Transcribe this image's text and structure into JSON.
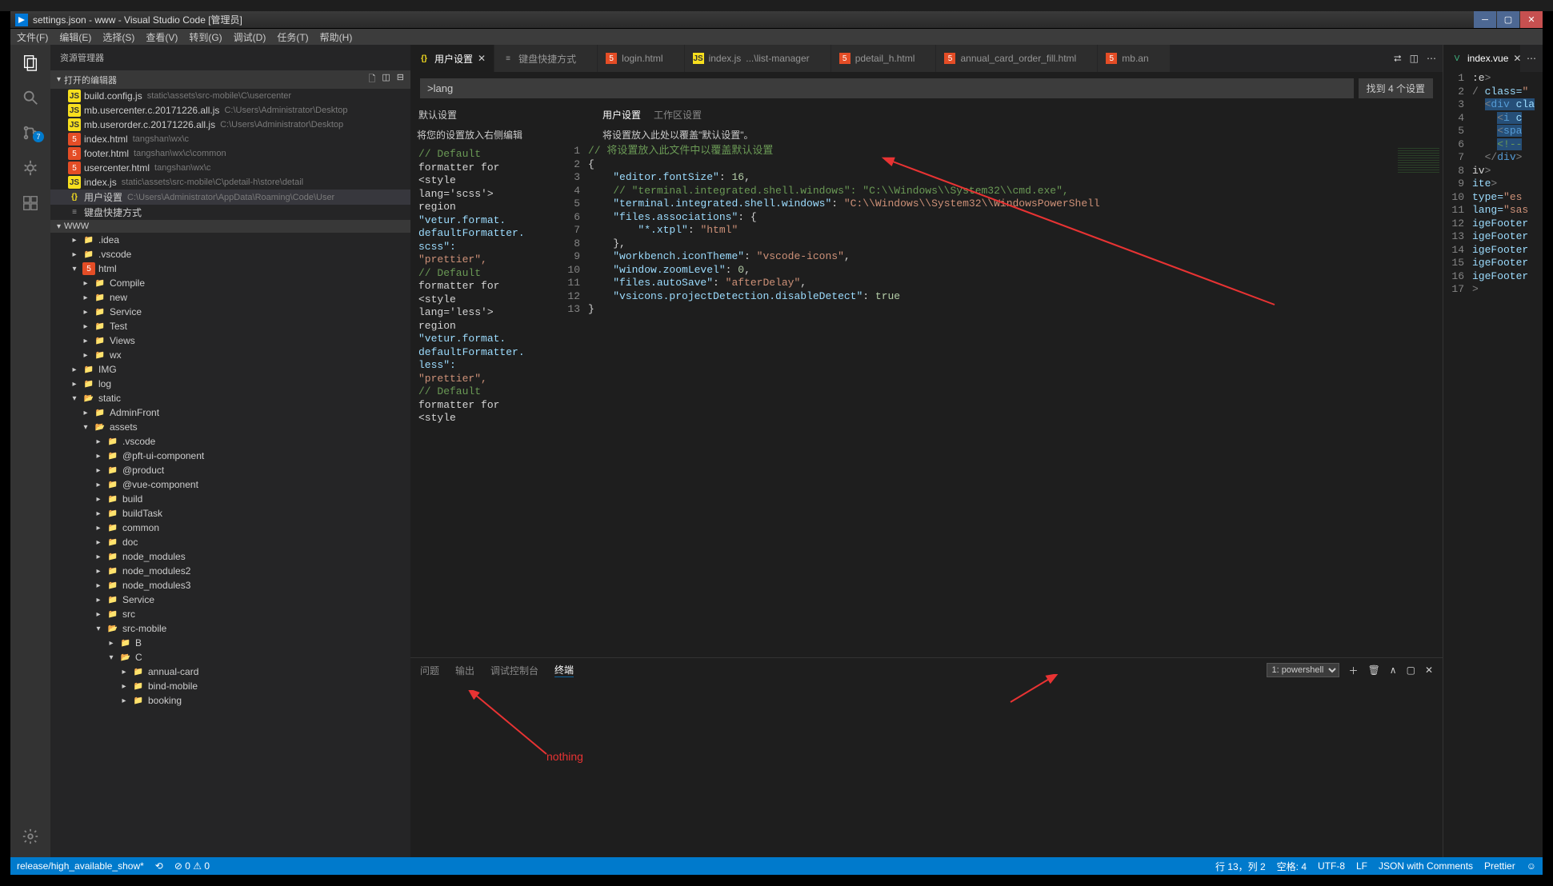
{
  "title": "settings.json - www - Visual Studio Code [管理员]",
  "menu": [
    "文件(F)",
    "编辑(E)",
    "选择(S)",
    "查看(V)",
    "转到(G)",
    "调试(D)",
    "任务(T)",
    "帮助(H)"
  ],
  "activity_badge": "7",
  "sidebar": {
    "title": "资源管理器",
    "open_editors_label": "打开的编辑器",
    "open_editors": [
      {
        "icon": "js",
        "name": "build.config.js",
        "dim": "static\\assets\\src-mobile\\C\\usercenter"
      },
      {
        "icon": "js",
        "name": "mb.usercenter.c.20171226.all.js",
        "dim": "C:\\Users\\Administrator\\Desktop"
      },
      {
        "icon": "js",
        "name": "mb.userorder.c.20171226.all.js",
        "dim": "C:\\Users\\Administrator\\Desktop"
      },
      {
        "icon": "html5",
        "name": "index.html",
        "dim": "tangshan\\wx\\c"
      },
      {
        "icon": "html5",
        "name": "footer.html",
        "dim": "tangshan\\wx\\c\\common"
      },
      {
        "icon": "html5",
        "name": "usercenter.html",
        "dim": "tangshan\\wx\\c"
      },
      {
        "icon": "js",
        "name": "index.js",
        "dim": "static\\assets\\src-mobile\\C\\pdetail-h\\store\\detail"
      },
      {
        "icon": "json",
        "name": "用户设置",
        "dim": "C:\\Users\\Administrator\\AppData\\Roaming\\Code\\User",
        "selected": true
      },
      {
        "icon": "txt",
        "name": "键盘快捷方式",
        "dim": ""
      }
    ],
    "root": "WWW",
    "tree": [
      {
        "indent": 1,
        "chev": "▸",
        "icon": "folder",
        "name": ".idea"
      },
      {
        "indent": 1,
        "chev": "▸",
        "icon": "folder",
        "name": ".vscode"
      },
      {
        "indent": 1,
        "chev": "▾",
        "icon": "html5",
        "name": "html"
      },
      {
        "indent": 2,
        "chev": "▸",
        "icon": "folder",
        "name": "Compile"
      },
      {
        "indent": 2,
        "chev": "▸",
        "icon": "folder",
        "name": "new"
      },
      {
        "indent": 2,
        "chev": "▸",
        "icon": "folder",
        "name": "Service"
      },
      {
        "indent": 2,
        "chev": "▸",
        "icon": "folder-red",
        "name": "Test"
      },
      {
        "indent": 2,
        "chev": "▸",
        "icon": "folder-purple",
        "name": "Views"
      },
      {
        "indent": 2,
        "chev": "▸",
        "icon": "folder",
        "name": "wx"
      },
      {
        "indent": 1,
        "chev": "▸",
        "icon": "folder-green",
        "name": "IMG"
      },
      {
        "indent": 1,
        "chev": "▸",
        "icon": "folder",
        "name": "log"
      },
      {
        "indent": 1,
        "chev": "▾",
        "icon": "folder",
        "name": "static"
      },
      {
        "indent": 2,
        "chev": "▸",
        "icon": "folder",
        "name": "AdminFront"
      },
      {
        "indent": 2,
        "chev": "▾",
        "icon": "folder-red",
        "name": "assets"
      },
      {
        "indent": 3,
        "chev": "▸",
        "icon": "folder",
        "name": ".vscode"
      },
      {
        "indent": 3,
        "chev": "▸",
        "icon": "folder",
        "name": "@pft-ui-component"
      },
      {
        "indent": 3,
        "chev": "▸",
        "icon": "folder",
        "name": "@product"
      },
      {
        "indent": 3,
        "chev": "▸",
        "icon": "folder",
        "name": "@vue-component"
      },
      {
        "indent": 3,
        "chev": "▸",
        "icon": "folder",
        "name": "build"
      },
      {
        "indent": 3,
        "chev": "▸",
        "icon": "folder",
        "name": "buildTask"
      },
      {
        "indent": 3,
        "chev": "▸",
        "icon": "folder",
        "name": "common"
      },
      {
        "indent": 3,
        "chev": "▸",
        "icon": "folder",
        "name": "doc"
      },
      {
        "indent": 3,
        "chev": "▸",
        "icon": "folder-green",
        "name": "node_modules"
      },
      {
        "indent": 3,
        "chev": "▸",
        "icon": "folder-green",
        "name": "node_modules2"
      },
      {
        "indent": 3,
        "chev": "▸",
        "icon": "folder-green",
        "name": "node_modules3"
      },
      {
        "indent": 3,
        "chev": "▸",
        "icon": "folder",
        "name": "Service"
      },
      {
        "indent": 3,
        "chev": "▸",
        "icon": "folder",
        "name": "src"
      },
      {
        "indent": 3,
        "chev": "▾",
        "icon": "folder",
        "name": "src-mobile"
      },
      {
        "indent": 4,
        "chev": "▸",
        "icon": "folder",
        "name": "B"
      },
      {
        "indent": 4,
        "chev": "▾",
        "icon": "folder",
        "name": "C"
      },
      {
        "indent": 5,
        "chev": "▸",
        "icon": "folder",
        "name": "annual-card"
      },
      {
        "indent": 5,
        "chev": "▸",
        "icon": "folder",
        "name": "bind-mobile"
      },
      {
        "indent": 5,
        "chev": "▸",
        "icon": "folder",
        "name": "booking"
      }
    ]
  },
  "tabs": [
    {
      "icon": "json",
      "label": "用户设置",
      "active": true,
      "close": true
    },
    {
      "icon": "txt",
      "label": "键盘快捷方式"
    },
    {
      "icon": "html5",
      "label": "login.html"
    },
    {
      "icon": "js",
      "label": "index.js",
      "dim": "...\\list-manager"
    },
    {
      "icon": "html5",
      "label": "pdetail_h.html"
    },
    {
      "icon": "html5",
      "label": "annual_card_order_fill.html"
    },
    {
      "icon": "html5",
      "label": "mb.an"
    }
  ],
  "right_tabs": [
    {
      "icon": "vue",
      "label": "index.vue",
      "active": true,
      "close": true
    }
  ],
  "search": {
    "value": ">lang",
    "count": "找到 4 个设置"
  },
  "settings_headers": {
    "default": "默认设置",
    "user": "用户设置",
    "workspace": "工作区设置"
  },
  "left_hint": "将您的设置放入右侧编辑",
  "right_hint": "将设置放入此处以覆盖\"默认设置\"。",
  "default_snippet": "  // Default\n  formatter for\n  <style\n  lang='scss'>\n  region\n  \"vetur.format.\n  defaultFormatter.\n  scss\":\n  \"prettier\",\n\n  // Default\n  formatter for\n  <style\n  lang='less'>\n  region\n  \"vetur.format.\n  defaultFormatter.\n  less\":\n  \"prettier\",\n\n  // Default\n  formatter for\n  <style",
  "code_lines": [
    {
      "n": 1,
      "html": "<span class='tok-comment'>// 将设置放入此文件中以覆盖默认设置</span>"
    },
    {
      "n": 2,
      "html": "<span class='tok-punct'>{</span>"
    },
    {
      "n": 3,
      "html": "    <span class='tok-key'>\"editor.fontSize\"</span>: <span class='tok-num'>16</span>,"
    },
    {
      "n": 4,
      "html": "    <span class='tok-comment'>// \"terminal.integrated.shell.windows\": \"C:\\\\Windows\\\\System32\\\\cmd.exe\",</span>"
    },
    {
      "n": 5,
      "html": "    <span class='tok-key'>\"terminal.integrated.shell.windows\"</span>: <span class='tok-string'>\"C:\\\\Windows\\\\System32\\\\WindowsPowerShell</span>"
    },
    {
      "n": 6,
      "html": "    <span class='tok-key'>\"files.associations\"</span>: {"
    },
    {
      "n": 7,
      "html": "        <span class='tok-key'>\"*.xtpl\"</span>: <span class='tok-string'>\"html\"</span>"
    },
    {
      "n": 8,
      "html": "    },"
    },
    {
      "n": 9,
      "html": "    <span class='tok-key'>\"workbench.iconTheme\"</span>: <span class='tok-string'>\"vscode-icons\"</span>,"
    },
    {
      "n": 10,
      "html": "    <span class='tok-key'>\"window.zoomLevel\"</span>: <span class='tok-num'>0</span>,"
    },
    {
      "n": 11,
      "html": "    <span class='tok-key'>\"files.autoSave\"</span>: <span class='tok-string'>\"afterDelay\"</span>,"
    },
    {
      "n": 12,
      "html": "    <span class='tok-key'>\"vsicons.projectDetection.disableDetect\"</span>: <span class='tok-num'>true</span>"
    },
    {
      "n": 13,
      "html": "<span class='tok-punct'>}</span>"
    }
  ],
  "right_code": [
    {
      "n": 1,
      "html": ":e<span class='tok-tag'>&gt;</span>"
    },
    {
      "n": 2,
      "html": "<span class='tok-tag'>&#47;</span> <span class='tok-attr'>class=</span><span class='tok-string'>\"</span>"
    },
    {
      "n": 3,
      "html": "  <span class='tok-tag tok-sel'>&lt;</span><span class='tok-name tok-sel'>div</span><span class='tok-sel'> </span><span class='tok-attr tok-sel'>cla</span>"
    },
    {
      "n": 4,
      "html": "    <span class='tok-tag tok-sel'>&lt;</span><span class='tok-name tok-sel'>i</span><span class='tok-sel'> </span><span class='tok-attr tok-sel'>c</span>"
    },
    {
      "n": 5,
      "html": "    <span class='tok-tag tok-sel'>&lt;</span><span class='tok-name tok-sel'>spa</span>"
    },
    {
      "n": 6,
      "html": "    <span class='tok-comment tok-sel'>&lt;!--</span>"
    },
    {
      "n": 7,
      "html": "  <span class='tok-tag'>&lt;/</span><span class='tok-name'>div</span><span class='tok-tag'>&gt;</span>"
    },
    {
      "n": 8,
      "html": "iv<span class='tok-tag'>&gt;</span>"
    },
    {
      "n": 9,
      "html": "<span class='tok-attr'>ite</span><span class='tok-tag'>&gt;</span>"
    },
    {
      "n": 10,
      "html": "<span class='tok-attr'>type=</span><span class='tok-string'>\"es</span>"
    },
    {
      "n": 11,
      "html": "<span class='tok-attr'>lang=</span><span class='tok-string'>\"sas</span>"
    },
    {
      "n": 12,
      "html": "<span class='tok-attr'>igeFooter</span>"
    },
    {
      "n": 13,
      "html": "<span class='tok-attr'>igeFooter</span>"
    },
    {
      "n": 14,
      "html": "<span class='tok-attr'>igeFooter</span>"
    },
    {
      "n": 15,
      "html": "<span class='tok-attr'>igeFooter</span>"
    },
    {
      "n": 16,
      "html": "<span class='tok-attr'>igeFooter</span>"
    },
    {
      "n": 17,
      "html": "<span class='tok-tag'>&gt;</span>"
    }
  ],
  "panel": {
    "tabs": [
      "问题",
      "输出",
      "调试控制台",
      "终端"
    ],
    "active": 3,
    "term_select": "1: powershell",
    "annotation": "nothing"
  },
  "status": {
    "left": [
      "release/high_available_show*",
      "⟲",
      "⊘ 0 ⚠ 0"
    ],
    "right": [
      "行 13，列 2",
      "空格: 4",
      "UTF-8",
      "LF",
      "JSON with Comments",
      "Prettier",
      "☺"
    ]
  }
}
